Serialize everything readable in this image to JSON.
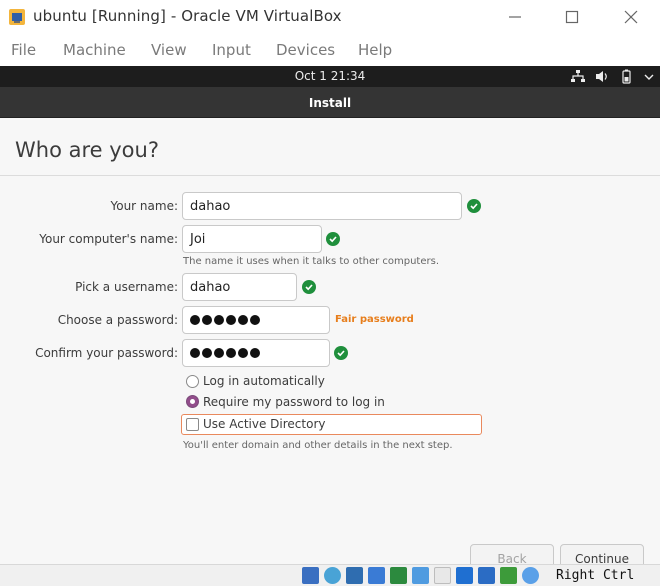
{
  "window": {
    "title": "ubuntu [Running] - Oracle VM VirtualBox",
    "icon": "virtualbox-icon",
    "controls": [
      "minimize-icon",
      "maximize-icon",
      "close-icon"
    ]
  },
  "menubar": {
    "items": [
      "File",
      "Machine",
      "View",
      "Input",
      "Devices",
      "Help"
    ]
  },
  "guest_topbar": {
    "clock": "Oct 1  21:34",
    "indicators": [
      "network-icon",
      "volume-icon",
      "battery-icon",
      "power-menu-icon"
    ]
  },
  "installer": {
    "header_title": "Install",
    "page_heading": "Who are you?",
    "fields": {
      "name_label": "Your name:",
      "name_value": "dahao",
      "computer_label": "Your computer's name:",
      "computer_value": "Joi",
      "computer_hint": "The name it uses when it talks to other computers.",
      "username_label": "Pick a username:",
      "username_value": "dahao",
      "password_label": "Choose a password:",
      "password_strength": "Fair password",
      "password_length": 6,
      "confirm_label": "Confirm your password:",
      "confirm_length": 6
    },
    "login_options": {
      "auto_login_label": "Log in automatically",
      "require_password_label": "Require my password to log in",
      "selected": "require_password"
    },
    "active_directory": {
      "label": "Use Active Directory",
      "checked": false,
      "hint": "You'll enter domain and other details in the next step."
    },
    "buttons": {
      "back_label": "Back",
      "continue_label": "Continue"
    }
  },
  "statusbar": {
    "host_key": "Right Ctrl",
    "icons": [
      "hard-disk-icon",
      "optical-drive-icon",
      "audio-icon",
      "network-status-icon",
      "usb-icon",
      "shared-folders-icon",
      "display-icon",
      "video-capture-icon",
      "mouse-integration-icon",
      "cpu-icon",
      "keyboard-capture-icon"
    ]
  },
  "colors": {
    "accent": "#924d8b",
    "success": "#1f8f3c",
    "warning": "#e77e1c",
    "focus_border": "#e9895d",
    "headerbar": "#343434",
    "topbar": "#1d1d1d"
  }
}
